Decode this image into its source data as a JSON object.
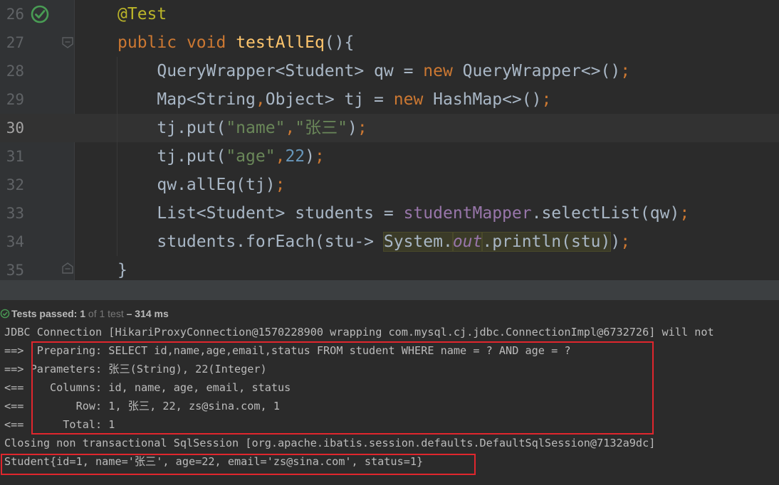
{
  "editor": {
    "lines": [
      {
        "num": "26",
        "current": false,
        "tokens": [
          [
            "ann",
            "@Test"
          ]
        ]
      },
      {
        "num": "27",
        "current": false,
        "tokens": [
          [
            "kw",
            "public "
          ],
          [
            "kw",
            "void "
          ],
          [
            "fn",
            "testAllEq"
          ],
          [
            "plain",
            "(){"
          ]
        ]
      },
      {
        "num": "28",
        "current": false,
        "tokens": [
          [
            "plain",
            "    QueryWrapper<Student> qw = "
          ],
          [
            "kw",
            "new "
          ],
          [
            "plain",
            "QueryWrapper<>()"
          ],
          [
            "kw",
            ";"
          ]
        ]
      },
      {
        "num": "29",
        "current": false,
        "tokens": [
          [
            "plain",
            "    Map<String"
          ],
          [
            "kw",
            ","
          ],
          [
            "plain",
            "Object> tj = "
          ],
          [
            "kw",
            "new "
          ],
          [
            "plain",
            "HashMap<>()"
          ],
          [
            "kw",
            ";"
          ]
        ]
      },
      {
        "num": "30",
        "current": true,
        "tokens": [
          [
            "plain",
            "    tj.put("
          ],
          [
            "str",
            "\"name\""
          ],
          [
            "kw",
            ","
          ],
          [
            "str",
            "\"张三\""
          ],
          [
            "plain",
            ")"
          ],
          [
            "kw",
            ";"
          ]
        ]
      },
      {
        "num": "31",
        "current": false,
        "tokens": [
          [
            "plain",
            "    tj.put("
          ],
          [
            "str",
            "\"age\""
          ],
          [
            "kw",
            ","
          ],
          [
            "num",
            "22"
          ],
          [
            "plain",
            ")"
          ],
          [
            "kw",
            ";"
          ]
        ]
      },
      {
        "num": "32",
        "current": false,
        "tokens": [
          [
            "plain",
            "    qw.allEq(tj)"
          ],
          [
            "kw",
            ";"
          ]
        ]
      },
      {
        "num": "33",
        "current": false,
        "tokens": [
          [
            "plain",
            "    List<Student> students = "
          ],
          [
            "field",
            "studentMapper"
          ],
          [
            "plain",
            ".selectList(qw)"
          ],
          [
            "kw",
            ";"
          ]
        ]
      },
      {
        "num": "34",
        "current": false,
        "tokens": [
          [
            "plain",
            "    students.forEach(stu-> "
          ],
          [
            "hl",
            "System."
          ],
          [
            "hlsf",
            "out"
          ],
          [
            "hl",
            ".println(stu)"
          ],
          [
            "plain",
            ")"
          ],
          [
            "kw",
            ";"
          ]
        ]
      },
      {
        "num": "35",
        "current": false,
        "tokens": [
          [
            "plain",
            "}"
          ]
        ]
      }
    ]
  },
  "status": {
    "label": "Tests passed: ",
    "count": "1",
    "of_text": " of 1 test",
    "duration": " – 314 ms"
  },
  "console": {
    "lines": [
      "JDBC Connection [HikariProxyConnection@1570228900 wrapping com.mysql.cj.jdbc.ConnectionImpl@6732726] will not",
      "==>  Preparing: SELECT id,name,age,email,status FROM student WHERE name = ? AND age = ?",
      "==> Parameters: 张三(String), 22(Integer)",
      "<==    Columns: id, name, age, email, status",
      "<==        Row: 1, 张三, 22, zs@sina.com, 1",
      "<==      Total: 1",
      "Closing non transactional SqlSession [org.apache.ibatis.session.defaults.DefaultSqlSession@7132a9dc]",
      "Student{id=1, name='张三', age=22, email='zs@sina.com', status=1}"
    ]
  },
  "colors": {
    "background": "#2b2b2b",
    "gutter": "#313335",
    "keyword": "#cc7832",
    "string": "#6a8759",
    "annotation": "#bbb529",
    "method": "#ffc66d",
    "highlight_box": "#e0262d",
    "pass_icon": "#499c54"
  }
}
